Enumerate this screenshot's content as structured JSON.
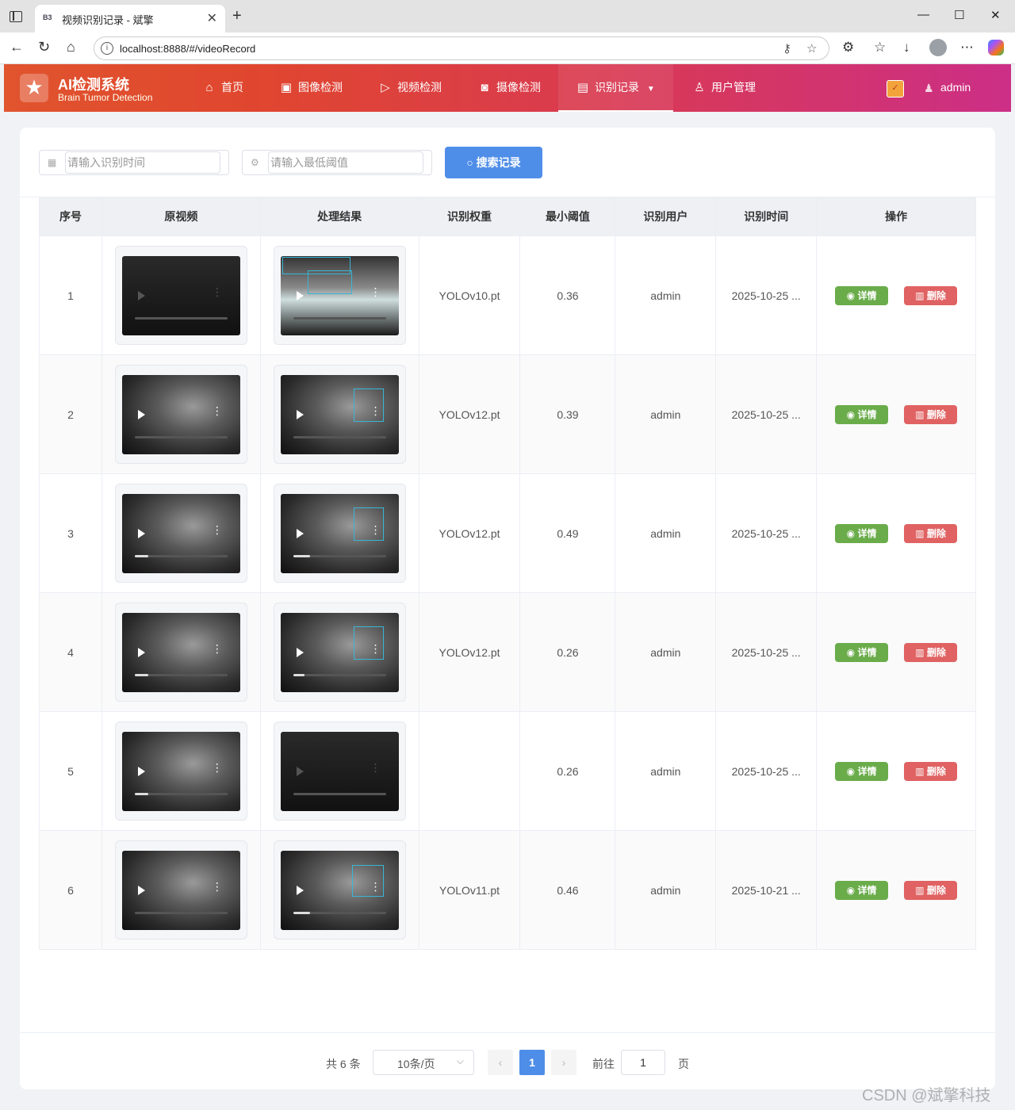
{
  "browser": {
    "tab_title": "视频识别记录 - 斌擎",
    "tab_favicon": "B3",
    "url": "localhost:8888/#/videoRecord"
  },
  "app": {
    "logo_title": "AI检测系统",
    "logo_subtitle": "Brain Tumor Detection",
    "menu": [
      {
        "label": "首页",
        "icon": "home-icon"
      },
      {
        "label": "图像检测",
        "icon": "image-icon"
      },
      {
        "label": "视频检测",
        "icon": "play-circle-icon"
      },
      {
        "label": "摄像检测",
        "icon": "camera-icon"
      },
      {
        "label": "识别记录",
        "icon": "document-icon",
        "active": true
      },
      {
        "label": "用户管理",
        "icon": "user-icon"
      }
    ],
    "user": "admin",
    "header_gradient": [
      "#e0542e",
      "#cc2f86"
    ]
  },
  "search": {
    "time_placeholder": "请输入识别时间",
    "threshold_placeholder": "请输入最低阈值",
    "button_label": "搜索记录"
  },
  "table": {
    "headers": [
      "序号",
      "原视频",
      "处理结果",
      "识别权重",
      "最小阈值",
      "识别用户",
      "识别时间",
      "操作"
    ],
    "rows": [
      {
        "index": "1",
        "weight": "YOLOv10.pt",
        "threshold": "0.36",
        "user": "admin",
        "time": "2025-10-25 ..."
      },
      {
        "index": "2",
        "weight": "YOLOv12.pt",
        "threshold": "0.39",
        "user": "admin",
        "time": "2025-10-25 ..."
      },
      {
        "index": "3",
        "weight": "YOLOv12.pt",
        "threshold": "0.49",
        "user": "admin",
        "time": "2025-10-25 ..."
      },
      {
        "index": "4",
        "weight": "YOLOv12.pt",
        "threshold": "0.26",
        "user": "admin",
        "time": "2025-10-25 ..."
      },
      {
        "index": "5",
        "weight": "",
        "threshold": "0.26",
        "user": "admin",
        "time": "2025-10-25 ..."
      },
      {
        "index": "6",
        "weight": "YOLOv11.pt",
        "threshold": "0.46",
        "user": "admin",
        "time": "2025-10-21 ..."
      }
    ],
    "detail_label": "详情",
    "delete_label": "删除"
  },
  "pagination": {
    "total": "共 6 条",
    "page_size": "10条/页",
    "current_page": "1",
    "goto_label": "前往",
    "goto_value": "1",
    "goto_suffix": "页"
  },
  "watermark": "CSDN @斌擎科技",
  "colors": {
    "primary": "#4f8ee8",
    "success": "#6aac4a",
    "danger": "#e06262"
  }
}
